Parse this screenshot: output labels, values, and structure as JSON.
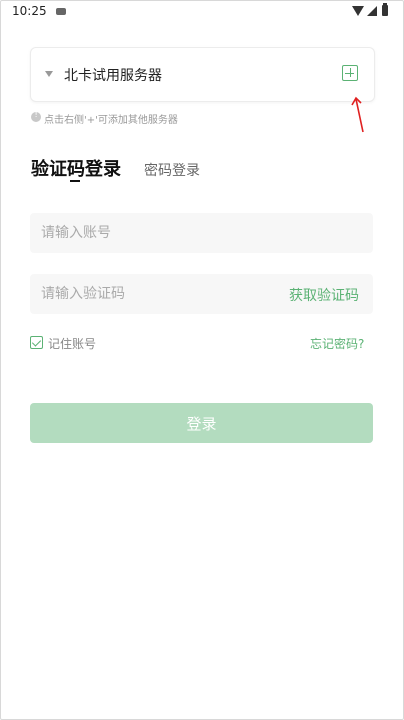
{
  "status_bar": {
    "time": "10:25"
  },
  "server": {
    "name": "北卡试用服务器",
    "hint": "点击右侧'+'可添加其他服务器"
  },
  "tabs": [
    {
      "label": "验证码登录",
      "active": true
    },
    {
      "label": "密码登录",
      "active": false
    }
  ],
  "form": {
    "account_placeholder": "请输入账号",
    "code_placeholder": "请输入验证码",
    "get_code_label": "获取验证码",
    "remember_label": "记住账号",
    "remember_checked": true,
    "forgot_label": "忘记密码?",
    "login_label": "登录"
  },
  "colors": {
    "accent": "#5bb274",
    "button_disabled": "#b3dcbf",
    "annotation_arrow": "#e02020"
  }
}
